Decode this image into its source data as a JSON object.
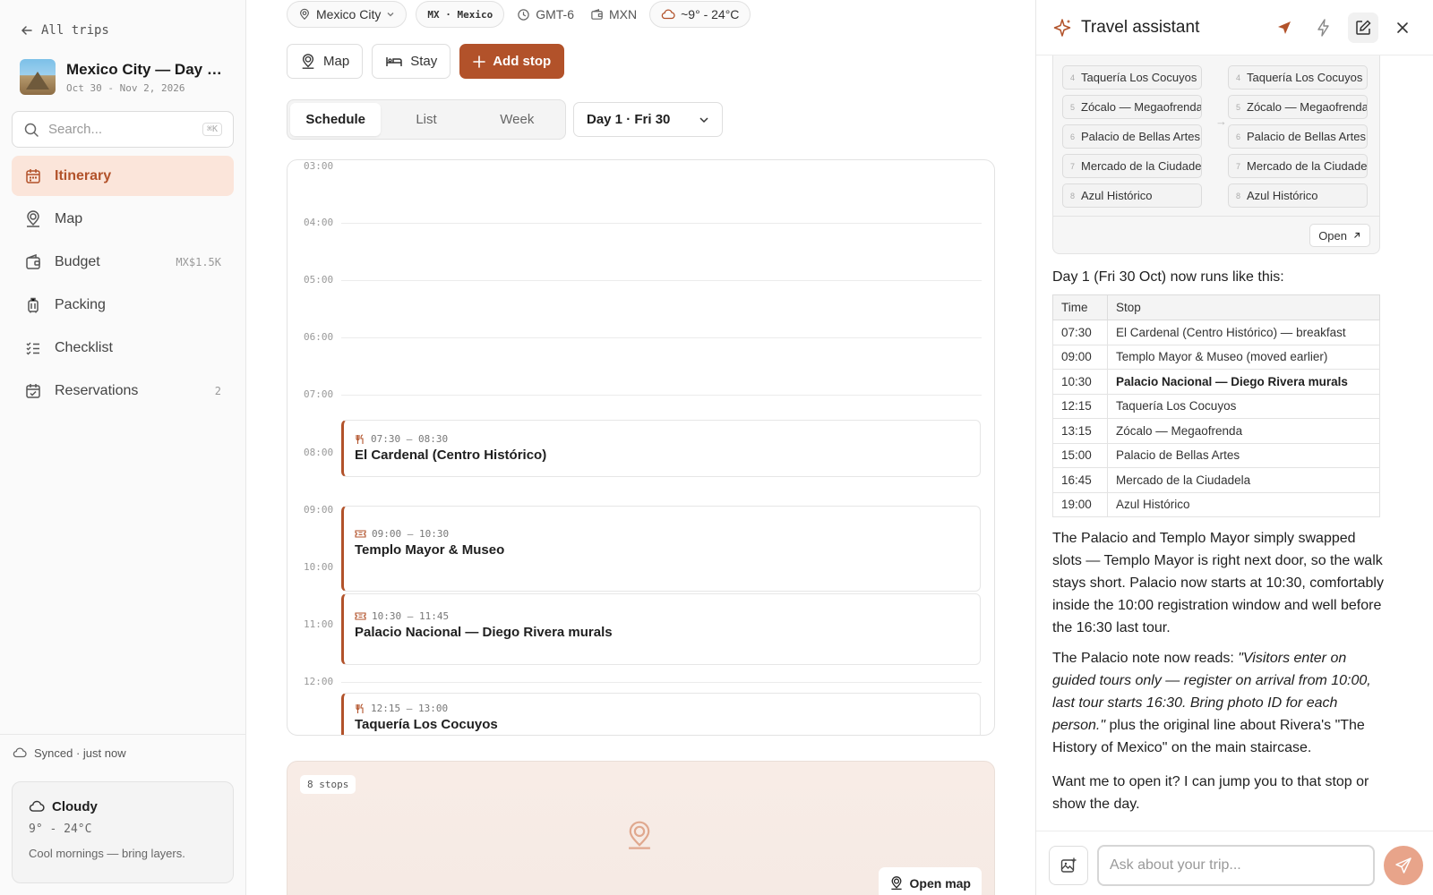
{
  "sidebar": {
    "back_label": "All trips",
    "trip": {
      "title": "Mexico City — Day of the Dead",
      "dates": "Oct 30 - Nov 2, 2026"
    },
    "search": {
      "placeholder": "Search...",
      "shortcut": "⌘K"
    },
    "nav": [
      {
        "label": "Itinerary",
        "extra": "",
        "icon": "calendar-icon",
        "active": true
      },
      {
        "label": "Map",
        "extra": "",
        "icon": "map-pin-icon",
        "active": false
      },
      {
        "label": "Budget",
        "extra": "MX$1.5K",
        "icon": "wallet-icon",
        "active": false
      },
      {
        "label": "Packing",
        "extra": "",
        "icon": "luggage-icon",
        "active": false
      },
      {
        "label": "Checklist",
        "extra": "",
        "icon": "checklist-icon",
        "active": false
      },
      {
        "label": "Reservations",
        "extra": "2",
        "icon": "calendar-check-icon",
        "active": false
      }
    ],
    "sync_status": "Synced · just now",
    "weather": {
      "condition": "Cloudy",
      "range": "9° - 24°C",
      "note": "Cool mornings — bring layers."
    }
  },
  "main": {
    "chips": {
      "city": "Mexico City",
      "country": "MX · Mexico",
      "timezone": "GMT-6",
      "currency": "MXN",
      "weather": "~9° - 24°C"
    },
    "actions": {
      "map": "Map",
      "stay": "Stay",
      "add_stop": "Add stop"
    },
    "view_tabs": [
      {
        "label": "Schedule",
        "active": true
      },
      {
        "label": "List",
        "active": false
      },
      {
        "label": "Week",
        "active": false
      }
    ],
    "day_select": "Day 1 · Fri 30",
    "hours": [
      "03:00",
      "04:00",
      "05:00",
      "06:00",
      "07:00",
      "08:00",
      "09:00",
      "10:00",
      "11:00",
      "12:00"
    ],
    "events": [
      {
        "time": "07:30 – 08:30",
        "title": "El Cardenal (Centro Histórico)",
        "icon": "fork-knife-icon"
      },
      {
        "time": "09:00 – 10:30",
        "title": "Templo Mayor & Museo",
        "icon": "ticket-icon"
      },
      {
        "time": "10:30 – 11:45",
        "title": "Palacio Nacional — Diego Rivera murals",
        "icon": "ticket-icon"
      },
      {
        "time": "12:15 – 13:00",
        "title": "Taquería Los Cocuyos",
        "icon": "fork-knife-icon"
      }
    ],
    "map_card": {
      "stops": "8 stops",
      "open_map": "Open map"
    }
  },
  "assistant": {
    "title": "Travel assistant",
    "diff": {
      "before": [
        {
          "n": "4",
          "label": "Taquería Los Cocuyos"
        },
        {
          "n": "5",
          "label": "Zócalo — Megaofrenda"
        },
        {
          "n": "6",
          "label": "Palacio de Bellas Artes"
        },
        {
          "n": "7",
          "label": "Mercado de la Ciudadela"
        },
        {
          "n": "8",
          "label": "Azul Histórico"
        }
      ],
      "after": [
        {
          "n": "4",
          "label": "Taquería Los Cocuyos"
        },
        {
          "n": "5",
          "label": "Zócalo — Megaofrenda"
        },
        {
          "n": "6",
          "label": "Palacio de Bellas Artes"
        },
        {
          "n": "7",
          "label": "Mercado de la Ciudadela"
        },
        {
          "n": "8",
          "label": "Azul Histórico"
        }
      ],
      "open_label": "Open"
    },
    "runs_intro": "Day 1 (Fri 30 Oct) now runs like this:",
    "table": {
      "headers": [
        "Time",
        "Stop"
      ],
      "rows": [
        {
          "time": "07:30",
          "stop": "El Cardenal (Centro Histórico) — breakfast",
          "bold": false
        },
        {
          "time": "09:00",
          "stop": "Templo Mayor & Museo (moved earlier)",
          "bold": false
        },
        {
          "time": "10:30",
          "stop": "Palacio Nacional — Diego Rivera murals",
          "bold": true
        },
        {
          "time": "12:15",
          "stop": "Taquería Los Cocuyos",
          "bold": false
        },
        {
          "time": "13:15",
          "stop": "Zócalo — Megaofrenda",
          "bold": false
        },
        {
          "time": "15:00",
          "stop": "Palacio de Bellas Artes",
          "bold": false
        },
        {
          "time": "16:45",
          "stop": "Mercado de la Ciudadela",
          "bold": false
        },
        {
          "time": "19:00",
          "stop": "Azul Histórico",
          "bold": false
        }
      ]
    },
    "para1": "The Palacio and Templo Mayor simply swapped slots — Templo Mayor is right next door, so the walk stays short. Palacio now starts at 10:30, comfortably inside the 10:00 registration window and well before the 16:30 last tour.",
    "para2_prefix": "The Palacio note now reads: ",
    "para2_quote": "\"Visitors enter on guided tours only — register on arrival from 10:00, last tour starts 16:30. Bring photo ID for each person.\"",
    "para2_suffix": " plus the original line about Rivera's \"The History of Mexico\" on the main staircase.",
    "para3": "Want me to open it? I can jump you to that stop or show the day.",
    "input_placeholder": "Ask about your trip..."
  },
  "colors": {
    "accent": "#b2522a",
    "accent_soft": "#fbe5da",
    "send_disabled": "#e8a48a"
  }
}
